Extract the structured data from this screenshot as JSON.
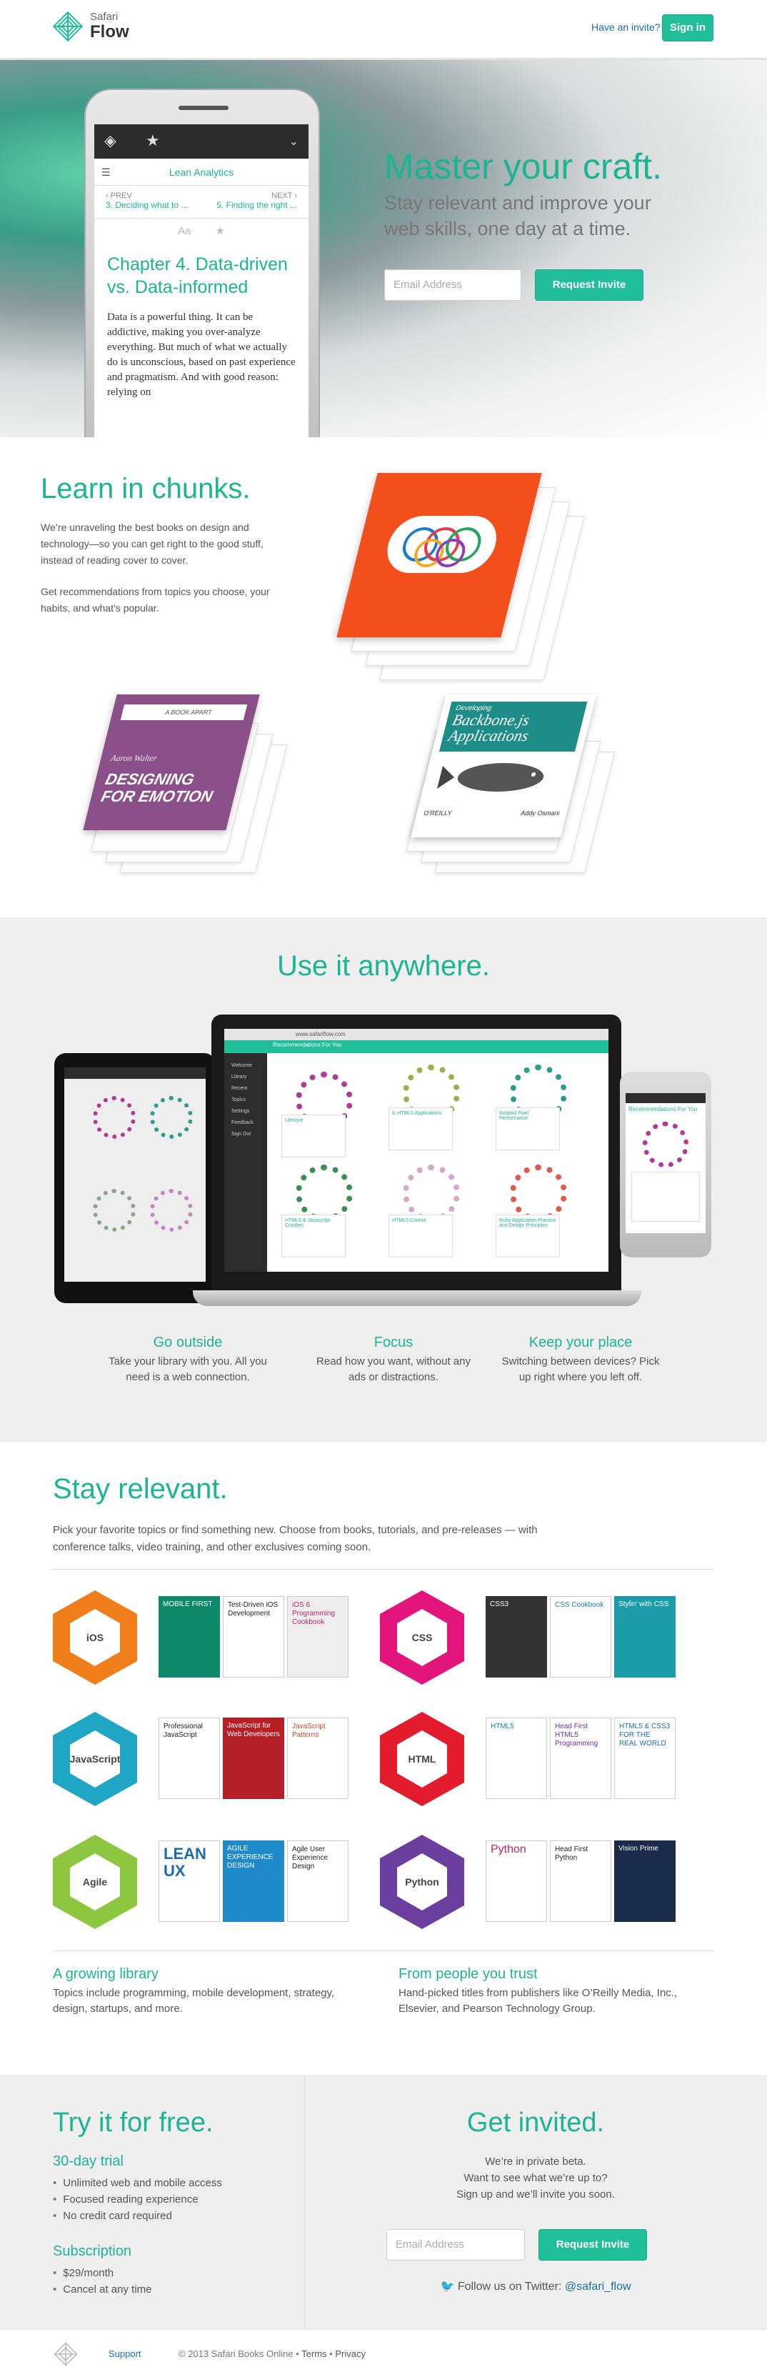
{
  "header": {
    "brand_small": "Safari",
    "brand_big": "Flow",
    "invite_link": "Have an invite?",
    "signin": "Sign in"
  },
  "hero": {
    "title": "Master your craft.",
    "subtitle": "Stay relevant and improve your web skills, one day at a time.",
    "email_placeholder": "Email Address",
    "request_button": "Request Invite",
    "reader": {
      "book_title": "Lean Analytics",
      "prev_label": "PREV",
      "prev_title": "3. Deciding what to ...",
      "next_label": "NEXT",
      "next_title": "5. Finding the right ...",
      "font_icon": "Aa",
      "chapter": "Chapter 4. Data-driven vs. Data-informed",
      "body": "Data is a powerful thing. It can be addictive, making you over-analyze everything. But much of what we actually do is unconscious, based on past experience and pragmatism. And with good reason: relying on"
    }
  },
  "learn": {
    "title": "Learn in chunks.",
    "p1": "We’re unraveling the best books on design and technology—so you can get right to the good stuff, instead of reading cover to cover.",
    "p2": "Get recommendations from topics you choose, your habits, and what’s popular.",
    "books": {
      "designing_top": "A BOOK APART",
      "designing_author": "Aaron Walter",
      "designing_title": "DESIGNING FOR EMOTION",
      "backbone_title": "Backbone.js Applications",
      "backbone_publisher": "O'REILLY",
      "backbone_author": "Addy Osmani",
      "backbone_kicker": "Developing"
    }
  },
  "anywhere": {
    "title": "Use it anywhere.",
    "laptop_url": "www.safariflow.com",
    "laptop_heading": "Recommendations For You",
    "phone_heading": "Recommendations For You",
    "sidebar_items": [
      "Welcome",
      "Library",
      "Recent",
      "Topics",
      "Settings",
      "Feedback",
      "Sign Out"
    ],
    "card_titles": [
      "Lifestyle",
      "iL HTML5 Applications",
      "Android Pixel Performance",
      "HTML5 & Javascript Crashes",
      "HTML5 Course",
      "Ruby Application Practice and Design Principles"
    ],
    "features": [
      {
        "title": "Go outside",
        "text": "Take your library with you. All you need is a web connection."
      },
      {
        "title": "Focus",
        "text": "Read how you want, without any ads or distractions."
      },
      {
        "title": "Keep your place",
        "text": "Switching between devices? Pick up right where you left off."
      }
    ]
  },
  "relevant": {
    "title": "Stay relevant.",
    "text": "Pick your favorite topics or find something new. Choose from books, tutorials, and pre-releases — with conference talks, video training, and other exclusives coming soon.",
    "topics": [
      "iOS",
      "CSS",
      "JavaScript",
      "HTML",
      "Agile",
      "Python"
    ],
    "covers": {
      "ios": [
        "MOBILE FIRST",
        "Test-Driven iOS Development",
        "iOS 6 Programming Cookbook"
      ],
      "css": [
        "CSS3",
        "CSS Cookbook",
        "Stylin' with CSS"
      ],
      "js": [
        "Professional JavaScript",
        "JavaScript for Web Developers",
        "JavaScript Patterns"
      ],
      "html": [
        "HTML5",
        "Head First HTML5 Programming",
        "HTML5 & CSS3 FOR THE REAL WORLD"
      ],
      "agile": [
        "LEAN UX",
        "AGILE EXPERIENCE DESIGN",
        "Agile User Experience Design"
      ],
      "python": [
        "Python",
        "Head First Python",
        "Vision Prime"
      ]
    },
    "library_title": "A growing library",
    "library_text": "Topics include programming, mobile development, strategy, design, startups, and more.",
    "people_title": "From people you trust",
    "people_text": "Hand-picked titles from publishers like O’Reilly Media, Inc., Elsevier, and Pearson Technology Group."
  },
  "try": {
    "title": "Try it for free.",
    "trial_title": "30-day trial",
    "trial_items": [
      "Unlimited web and mobile access",
      "Focused reading experience",
      "No credit card required"
    ],
    "sub_title": "Subscription",
    "sub_items": [
      "$29/month",
      "Cancel at any time"
    ]
  },
  "invite": {
    "title": "Get invited.",
    "line1": "We’re in private beta.",
    "line2": "Want to see what we’re up to?",
    "line3": "Sign up and we’ll invite you soon.",
    "email_placeholder": "Email Address",
    "button": "Request Invite",
    "twitter_text": "Follow us on Twitter:",
    "twitter_handle": "@safari_flow"
  },
  "footer": {
    "support": "Support",
    "copyright": "© 2013 Safari Books Online",
    "terms": "Terms",
    "privacy": "Privacy"
  },
  "colors": {
    "accent": "#20bf9a",
    "link": "#1b6fa3"
  }
}
